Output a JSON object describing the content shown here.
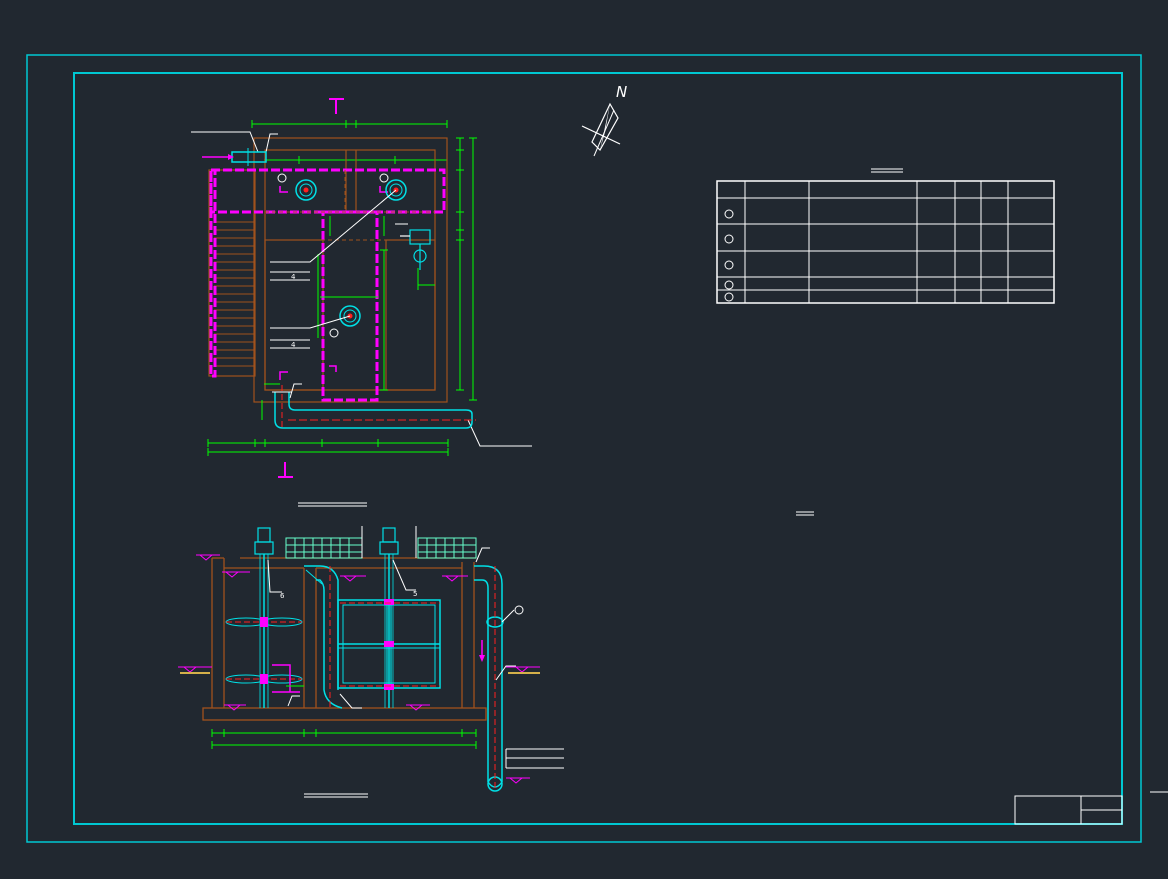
{
  "drawing": {
    "north_label": "N",
    "colors": {
      "background": "#212830",
      "frame": "#00c8d2",
      "structure": "#a0521d",
      "steel": "#ff00ff",
      "dimension": "#00ff00",
      "pipe": "#00e0e6",
      "text": "#ffffff",
      "centerline": "#ff2020",
      "grating": "#66ffcc"
    }
  },
  "equipment_table": {
    "row_count": 5
  },
  "title_block": {}
}
